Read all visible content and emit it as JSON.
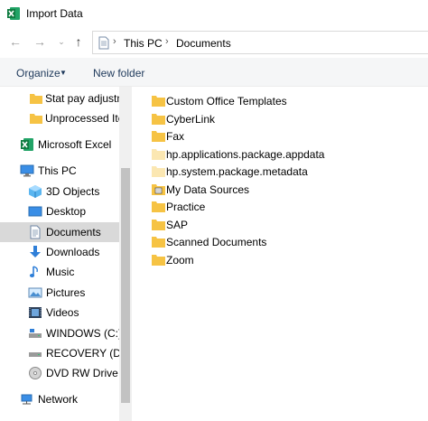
{
  "window": {
    "title": "Import Data"
  },
  "address": {
    "crumbs": [
      "This PC",
      "Documents"
    ]
  },
  "toolbar": {
    "organize_label": "Organize",
    "new_folder_label": "New folder"
  },
  "sidebar": {
    "items": [
      {
        "label": "Stat pay adjustm",
        "icon": "folder-icon"
      },
      {
        "label": "Unprocessed Iter",
        "icon": "folder-icon"
      },
      {
        "label": "Microsoft Excel",
        "icon": "excel-icon"
      },
      {
        "label": "This PC",
        "icon": "computer-icon"
      },
      {
        "label": "3D Objects",
        "icon": "3d-objects-icon"
      },
      {
        "label": "Desktop",
        "icon": "desktop-icon"
      },
      {
        "label": "Documents",
        "icon": "documents-icon",
        "selected": true
      },
      {
        "label": "Downloads",
        "icon": "downloads-icon"
      },
      {
        "label": "Music",
        "icon": "music-icon"
      },
      {
        "label": "Pictures",
        "icon": "pictures-icon"
      },
      {
        "label": "Videos",
        "icon": "videos-icon"
      },
      {
        "label": "WINDOWS (C:)",
        "icon": "drive-icon"
      },
      {
        "label": "RECOVERY (D:)",
        "icon": "drive-icon"
      },
      {
        "label": "DVD RW Drive (E",
        "icon": "dvd-drive-icon"
      },
      {
        "label": "Network",
        "icon": "network-icon"
      }
    ]
  },
  "files": [
    {
      "name": "Custom Office Templates",
      "icon": "folder-icon"
    },
    {
      "name": "CyberLink",
      "icon": "folder-icon"
    },
    {
      "name": "Fax",
      "icon": "folder-icon"
    },
    {
      "name": "hp.applications.package.appdata",
      "icon": "folder-light-icon"
    },
    {
      "name": "hp.system.package.metadata",
      "icon": "folder-light-icon"
    },
    {
      "name": "My Data Sources",
      "icon": "data-sources-folder-icon"
    },
    {
      "name": "Practice",
      "icon": "folder-icon"
    },
    {
      "name": "SAP",
      "icon": "folder-icon"
    },
    {
      "name": "Scanned Documents",
      "icon": "folder-icon"
    },
    {
      "name": "Zoom",
      "icon": "folder-icon"
    }
  ],
  "colors": {
    "folder": "#f6c344",
    "folder_light": "#fbe7b2",
    "selected_bg": "#d9d9d9",
    "command_text": "#1e395b",
    "excel_green": "#1d6f42"
  }
}
